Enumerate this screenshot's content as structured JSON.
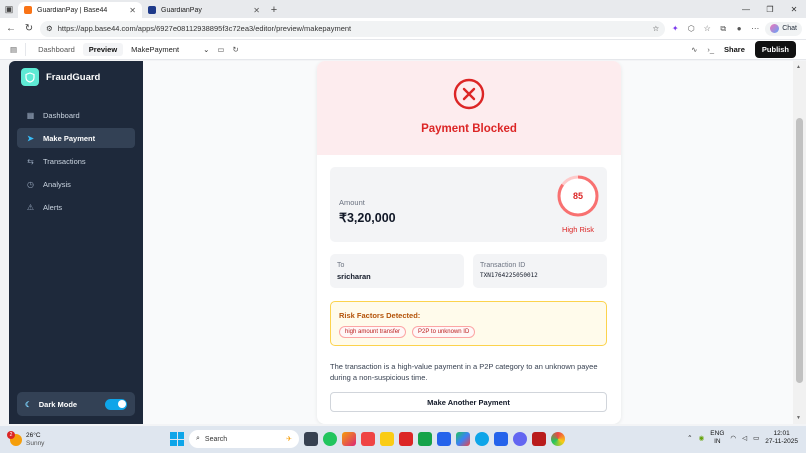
{
  "browser": {
    "tabs": [
      {
        "title": "GuardianPay | Base44",
        "active": true
      },
      {
        "title": "GuardianPay",
        "active": false
      }
    ],
    "url": "https://app.base44.com/apps/6927e08112938895f3c72ea3/editor/preview/makepayment",
    "chat_label": "Chat"
  },
  "toolbar": {
    "dashboard_label": "Dashboard",
    "preview_label": "Preview",
    "page_select": "MakePayment",
    "share_label": "Share",
    "publish_label": "Publish"
  },
  "sidebar": {
    "brand": "FraudGuard",
    "items": [
      {
        "label": "Dashboard",
        "icon": "grid-icon"
      },
      {
        "label": "Make Payment",
        "icon": "send-icon",
        "active": true
      },
      {
        "label": "Transactions",
        "icon": "swap-icon"
      },
      {
        "label": "Analysis",
        "icon": "clock-icon"
      },
      {
        "label": "Alerts",
        "icon": "bell-icon"
      }
    ],
    "dark_mode_label": "Dark Mode",
    "dark_mode_on": true
  },
  "result": {
    "title": "Payment Blocked",
    "amount_label": "Amount",
    "amount": "₹3,20,000",
    "risk_score": "85",
    "risk_score_value": 85,
    "risk_level": "High Risk",
    "to_label": "To",
    "to_value": "sricharan",
    "txn_label": "Transaction ID",
    "txn_value": "TXN1764225050012",
    "risk_factors_title": "Risk Factors Detected:",
    "risk_factors": [
      "high amount transfer",
      "P2P to unknown ID"
    ],
    "description": "The transaction is a high-value payment in a P2P category to an unknown payee during a non-suspicious time.",
    "button_label": "Make Another Payment"
  },
  "colors": {
    "danger": "#dc2626",
    "sidebar_bg": "#1e293b",
    "accent": "#0ea5e9",
    "warning_border": "#fcd34d"
  },
  "taskbar": {
    "weather_badge": "2",
    "temperature": "26°C",
    "weather": "Sunny",
    "search_placeholder": "Search",
    "lang_1": "ENG",
    "lang_2": "IN",
    "time": "12:01",
    "date": "27-11-2025"
  }
}
